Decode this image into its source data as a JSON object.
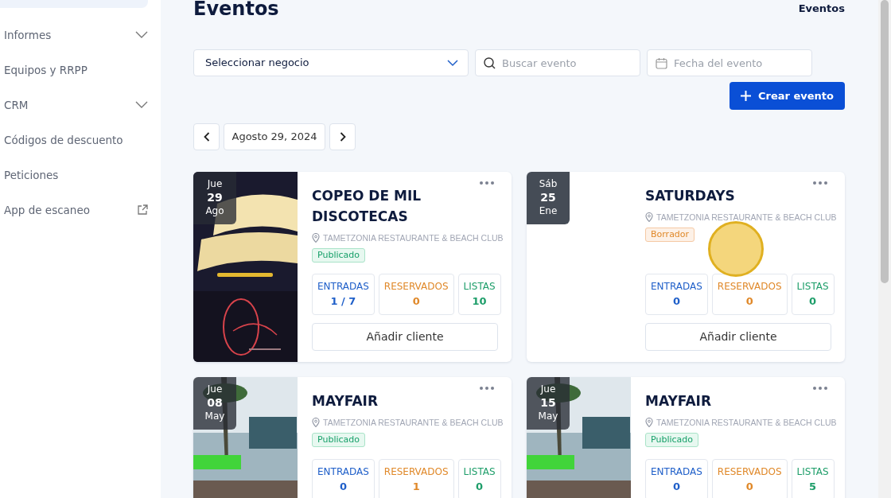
{
  "sidebar": {
    "items": [
      {
        "label": "Informes",
        "kind": "expandable"
      },
      {
        "label": "Equipos y RRPP",
        "kind": "link"
      },
      {
        "label": "CRM",
        "kind": "expandable"
      },
      {
        "label": "Códigos de descuento",
        "kind": "link"
      },
      {
        "label": "Peticiones",
        "kind": "link"
      },
      {
        "label": "App de escaneo",
        "kind": "external"
      }
    ]
  },
  "header": {
    "title": "Eventos",
    "breadcrumb": "Eventos"
  },
  "filters": {
    "business": {
      "value": "Seleccionar negocio"
    },
    "search": {
      "placeholder": "Buscar evento"
    },
    "date": {
      "placeholder": "Fecha del evento"
    }
  },
  "create_button": "Crear evento",
  "date_nav": {
    "label": "Agosto 29, 2024"
  },
  "events": [
    {
      "weekday": "Jue",
      "day": "29",
      "month": "Ago",
      "picture": true,
      "title": "COPEO DE MIL DISCOTECAS",
      "venue": "TAMETZONIA RESTAURANTE & BEACH CLUB",
      "status": {
        "label": "Publicado",
        "kind": "published"
      },
      "stats": [
        {
          "label": "ENTRADAS",
          "value": "1 / 7",
          "kind": "tickets"
        },
        {
          "label": "RESERVADOS",
          "value": "0",
          "kind": "reserved"
        },
        {
          "label": "LISTAS",
          "value": "10",
          "kind": "lists"
        }
      ],
      "button": "Añadir cliente"
    },
    {
      "weekday": "Sáb",
      "day": "25",
      "month": "Ene",
      "title": "SATURDAYS",
      "venue": "TAMETZONIA RESTAURANTE & BEACH CLUB",
      "status": {
        "label": "Borrador",
        "kind": "draft"
      },
      "stats": [
        {
          "label": "ENTRADAS",
          "value": "0",
          "kind": "tickets"
        },
        {
          "label": "RESERVADOS",
          "value": "0",
          "kind": "reserved"
        },
        {
          "label": "LISTAS",
          "value": "0",
          "kind": "lists"
        }
      ],
      "button": "Añadir cliente"
    },
    {
      "weekday": "Jue",
      "day": "08",
      "month": "May",
      "picture": true,
      "title": "MAYFAIR",
      "venue": "TAMETZONIA RESTAURANTE & BEACH CLUB",
      "status": {
        "label": "Publicado",
        "kind": "published"
      },
      "stats": [
        {
          "label": "ENTRADAS",
          "value": "0",
          "kind": "tickets"
        },
        {
          "label": "RESERVADOS",
          "value": "1",
          "kind": "reserved"
        },
        {
          "label": "LISTAS",
          "value": "0",
          "kind": "lists"
        }
      ]
    },
    {
      "weekday": "Jue",
      "day": "15",
      "month": "May",
      "picture": true,
      "title": "MAYFAIR",
      "venue": "TAMETZONIA RESTAURANTE & BEACH CLUB",
      "status": {
        "label": "Publicado",
        "kind": "published"
      },
      "stats": [
        {
          "label": "ENTRADAS",
          "value": "0",
          "kind": "tickets"
        },
        {
          "label": "RESERVADOS",
          "value": "0",
          "kind": "reserved"
        },
        {
          "label": "LISTAS",
          "value": "5",
          "kind": "lists"
        }
      ]
    }
  ]
}
